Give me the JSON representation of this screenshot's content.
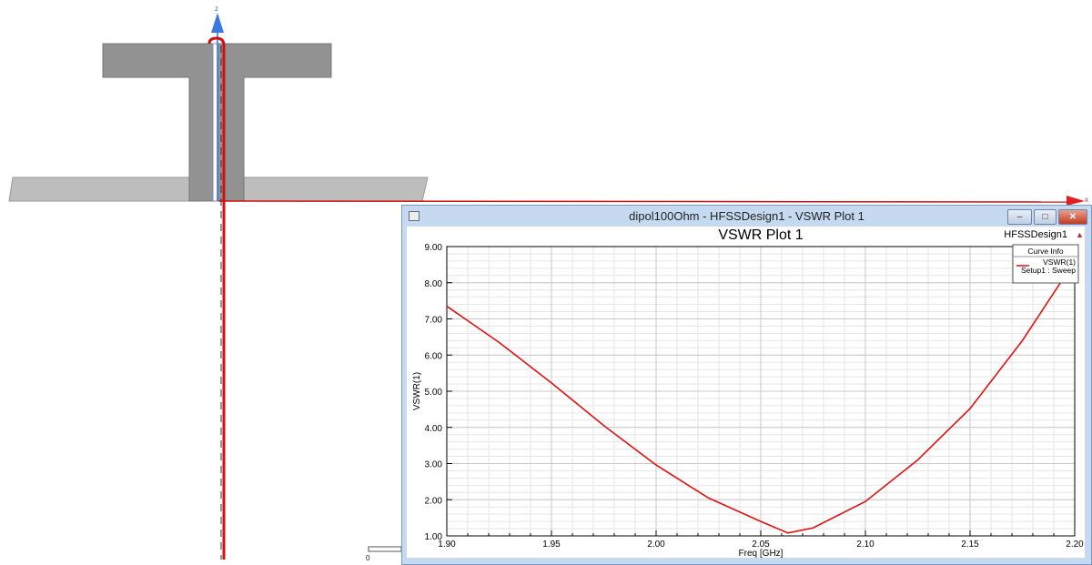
{
  "view3d": {
    "axis_z": "z",
    "axis_x": "x",
    "scale_zero": "0"
  },
  "window": {
    "title": "dipol100Ohm - HFSSDesign1 - VSWR Plot 1",
    "minimize": "–",
    "maximize": "□",
    "close": "✕"
  },
  "chart_data": {
    "type": "line",
    "title": "VSWR Plot 1",
    "design_label": "HFSSDesign1",
    "xlabel": "Freq [GHz]",
    "ylabel": "VSWR(1)",
    "xlim": [
      1.9,
      2.2
    ],
    "ylim": [
      1.0,
      9.0
    ],
    "xticks": [
      "1.90",
      "1.95",
      "2.00",
      "2.05",
      "2.10",
      "2.15",
      "2.20"
    ],
    "yticks": [
      "1.00",
      "2.00",
      "3.00",
      "4.00",
      "5.00",
      "6.00",
      "7.00",
      "8.00",
      "9.00"
    ],
    "grid": true,
    "legend": {
      "title": "Curve Info",
      "position": "top-right",
      "entries": [
        {
          "name": "VSWR(1)",
          "sub": "Setup1 : Sweep",
          "color": "#e01010"
        }
      ]
    },
    "series": [
      {
        "name": "VSWR(1)",
        "color": "#e01010",
        "x": [
          1.9,
          1.925,
          1.95,
          1.975,
          2.0,
          2.025,
          2.05,
          2.063,
          2.075,
          2.1,
          2.125,
          2.15,
          2.175,
          2.2
        ],
        "y": [
          7.35,
          6.35,
          5.23,
          4.05,
          2.96,
          2.05,
          1.4,
          1.08,
          1.22,
          1.95,
          3.1,
          4.52,
          6.4,
          8.6
        ]
      }
    ]
  }
}
